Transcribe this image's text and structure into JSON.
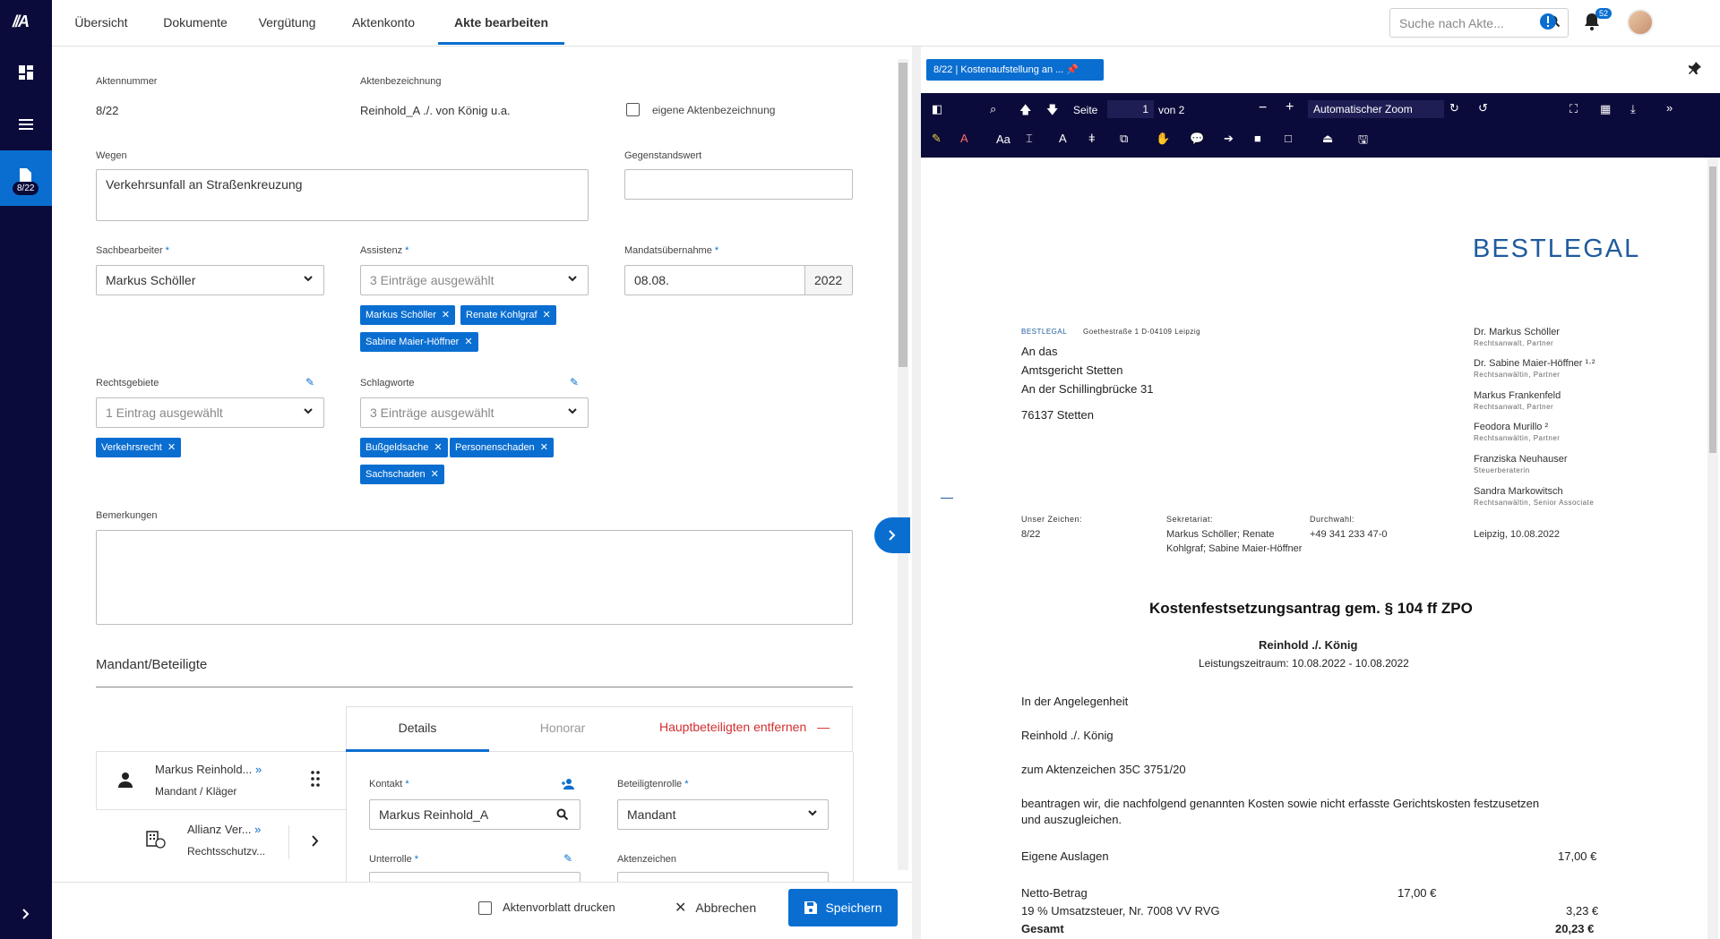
{
  "sidebar": {
    "logo": "//A",
    "active_badge": "8/22"
  },
  "nav": {
    "tabs": [
      "Übersicht",
      "Dokumente",
      "Vergütung",
      "Aktenkonto",
      "Akte bearbeiten"
    ],
    "search_placeholder": "Suche nach Akte...",
    "notifications": "52"
  },
  "form": {
    "aktennummer_label": "Aktennummer",
    "aktennummer": "8/22",
    "aktenbezeichnung_label": "Aktenbezeichnung",
    "aktenbezeichnung": "Reinhold_A ./. von König u.a.",
    "eigene_label": "eigene Aktenbezeichnung",
    "wegen_label": "Wegen",
    "wegen": "Verkehrsunfall an Straßenkreuzung",
    "gegenstandswert_label": "Gegenstandswert",
    "sachbearbeiter_label": "Sachbearbeiter",
    "sachbearbeiter": "Markus Schöller",
    "assistenz_label": "Assistenz",
    "assistenz": "3 Einträge ausgewählt",
    "assistenz_chips": [
      "Markus Schöller",
      "Renate Kohlgraf",
      "Sabine Maier-Höffner"
    ],
    "mandat_label": "Mandatsübernahme",
    "mandat_date": "08.08.",
    "mandat_year": "2022",
    "rechtsgebiete_label": "Rechtsgebiete",
    "rechtsgebiete": "1 Eintrag ausgewählt",
    "rechtsgebiete_chips": [
      "Verkehrsrecht"
    ],
    "schlagworte_label": "Schlagworte",
    "schlagworte": "3 Einträge ausgewählt",
    "schlagworte_chips": [
      "Bußgeldsache",
      "Personenschaden",
      "Sachschaden"
    ],
    "bemerkungen_label": "Bemerkungen",
    "mandant_title": "Mandant/Beteiligte",
    "party1_name": "Markus Reinhold...",
    "party1_role": "Mandant / Kläger",
    "party2_name": "Allianz Ver...",
    "party2_role": "Rechtsschutzv...",
    "tab_details": "Details",
    "tab_honorar": "Honorar",
    "remove_label": "Hauptbeteiligten entfernen",
    "kontakt_label": "Kontakt",
    "kontakt": "Markus Reinhold_A",
    "rolle_label": "Beteiligtenrolle",
    "rolle": "Mandant",
    "unterrolle_label": "Unterrolle",
    "aktenzeichen_label": "Aktenzeichen"
  },
  "footer": {
    "print_label": "Aktenvorblatt drucken",
    "cancel": "Abbrechen",
    "save": "Speichern"
  },
  "viewer": {
    "doc_tab": "8/22 |     Kostenaufstellung an ...",
    "page_label": "Seite",
    "page": "1",
    "page_total": "von 2",
    "zoom": "Automatischer Zoom"
  },
  "letter": {
    "logo": "BESTLEGAL",
    "sender_brand": "BESTLEGAL",
    "sender_addr": "Goethestraße 1   D-04109 Leipzig",
    "recipient": [
      "An das",
      "Amtsgericht Stetten",
      "An der Schillingbrücke 31",
      "76137 Stetten"
    ],
    "lawyers": [
      {
        "name": "Dr. Markus Schöller",
        "title": "Rechtsanwalt, Partner"
      },
      {
        "name": "Dr. Sabine Maier-Höffner ¹·²",
        "title": "Rechtsanwältin, Partner"
      },
      {
        "name": "Markus Frankenfeld",
        "title": "Rechtsanwalt, Partner"
      },
      {
        "name": "Feodora Murillo ²",
        "title": "Rechtsanwältin, Partner"
      },
      {
        "name": "Franziska Neuhauser",
        "title": "Steuerberaterin"
      },
      {
        "name": "Sandra Markowitsch",
        "title": "Rechtsanwältin, Senior Associate"
      }
    ],
    "ref_label": "Unser Zeichen:",
    "ref": "8/22",
    "sek_label": "Sekretariat:",
    "sek_line1": "Markus Schöller; Renate",
    "sek_line2": "Kohlgraf; Sabine Maier-Höffner",
    "dw_label": "Durchwahl:",
    "dw": "+49 341 233 47-0",
    "date": "Leipzig, 10.08.2022",
    "title": "Kostenfestsetzungsantrag gem. § 104 ff ZPO",
    "subtitle": "Reinhold ./. König",
    "period": "Leistungszeitraum: 10.08.2022 - 10.08.2022",
    "p1": "In der Angelegenheit",
    "p2": "Reinhold ./. König",
    "p3": "zum Aktenzeichen 35C 3751/20",
    "p4a": "beantragen wir, die nachfolgend genannten Kosten sowie nicht erfasste Gerichtskosten festzusetzen",
    "p4b": "und auszugleichen.",
    "eig_label": "Eigene Auslagen",
    "eig": "17,00 €",
    "netto_label": "Netto-Betrag",
    "netto": "17,00 €",
    "ust_label": "19 % Umsatzsteuer, Nr. 7008 VV RVG",
    "ust": "3,23 €",
    "total_label": "Gesamt",
    "total": "20,23 €"
  }
}
